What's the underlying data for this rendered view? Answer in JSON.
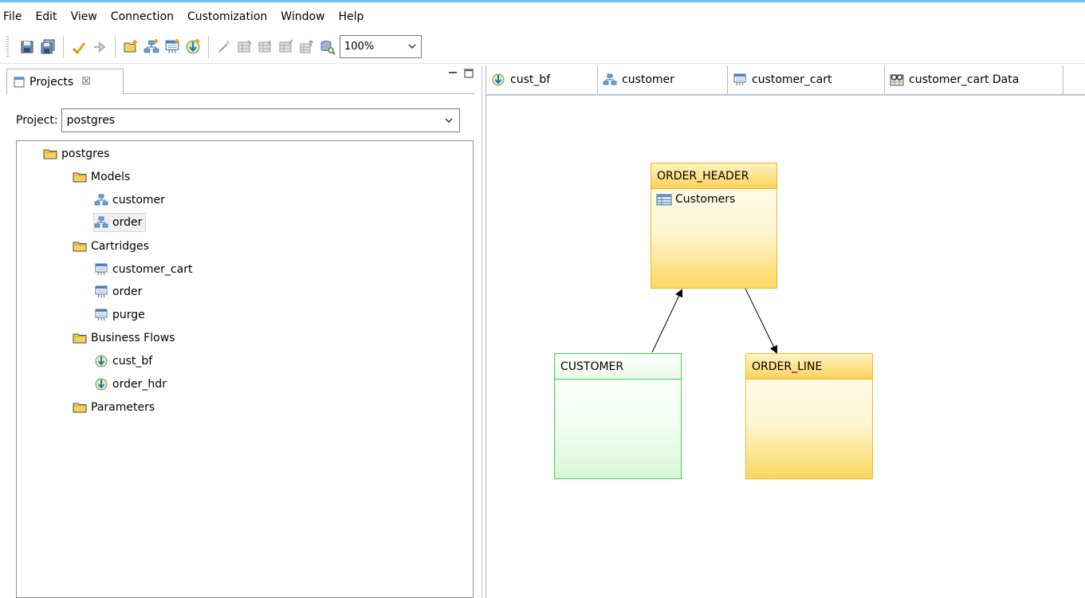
{
  "menu": [
    "File",
    "Edit",
    "View",
    "Connection",
    "Customization",
    "Window",
    "Help"
  ],
  "toolbar": {
    "zoom_value": "100%"
  },
  "projects_panel": {
    "tab_label": "Projects",
    "tab_close": "☒",
    "project_label": "Project:",
    "project_value": "postgres",
    "tree": [
      {
        "label": "postgres",
        "icon": "folder-icon"
      },
      {
        "label": "Models",
        "icon": "folder-icon"
      },
      {
        "label": "customer",
        "icon": "model-icon"
      },
      {
        "label": "order",
        "icon": "model-icon"
      },
      {
        "label": "Cartridges",
        "icon": "folder-icon"
      },
      {
        "label": "customer_cart",
        "icon": "cartridge-icon"
      },
      {
        "label": "order",
        "icon": "cartridge-icon"
      },
      {
        "label": "purge",
        "icon": "cartridge-icon"
      },
      {
        "label": "Business Flows",
        "icon": "folder-icon"
      },
      {
        "label": "cust_bf",
        "icon": "business-flow-icon"
      },
      {
        "label": "order_hdr",
        "icon": "business-flow-icon"
      },
      {
        "label": "Parameters",
        "icon": "folder-icon"
      }
    ]
  },
  "editor": {
    "tabs": [
      {
        "label": "cust_bf",
        "icon": "business-flow-icon"
      },
      {
        "label": "customer",
        "icon": "model-icon"
      },
      {
        "label": "customer_cart",
        "icon": "cartridge-icon"
      },
      {
        "label": "customer_cart Data",
        "icon": "data-glasses-icon"
      }
    ]
  },
  "diagram": {
    "entities": [
      {
        "name": "ORDER_HEADER",
        "color": "#e8b923",
        "members": [
          "Customers"
        ]
      },
      {
        "name": "CUSTOMER",
        "color": "#3bd44c",
        "members": []
      },
      {
        "name": "ORDER_LINE",
        "color": "#e8b923",
        "members": []
      }
    ],
    "relations": [
      {
        "from": "CUSTOMER",
        "to": "ORDER_HEADER"
      },
      {
        "from": "ORDER_HEADER",
        "to": "ORDER_LINE"
      }
    ]
  },
  "colors": {
    "accent": "#6cc3e8",
    "yellow_entity": "#fbd25a",
    "green_entity": "#3bd44c"
  }
}
